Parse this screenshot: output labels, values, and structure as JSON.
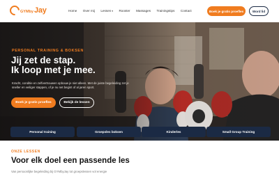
{
  "brand": {
    "logo_small": "GYMbyJay",
    "logo_prefix": "GYM",
    "logo_by": "by",
    "logo_name": "Jay"
  },
  "nav": {
    "items": [
      {
        "label": "Home"
      },
      {
        "label": "Over mij"
      },
      {
        "label": "Lessen",
        "has_dropdown": true
      },
      {
        "label": "Rooster"
      },
      {
        "label": "Massages"
      },
      {
        "label": "Trainingstips"
      },
      {
        "label": "Contact"
      }
    ],
    "cta_label": "Boek je gratis proefles",
    "member_label": "Word lid"
  },
  "hero": {
    "eyebrow": "PERSONAL TRAINING & BOKSEN",
    "headline_line1": "Jij zet de stap.",
    "headline_line2": "Ik loop met je mee.",
    "subtext": "Kracht, conditie en zelfvertrouwen opbouw je niet alleen. Met de juiste begeleiding zet je sneller en veiliger stappen, of je nu net begint of al jaren sport.",
    "cta_label": "Boek je gratis proefles",
    "secondary_label": "Bekijk de lessen"
  },
  "categories": [
    {
      "label": "Personal training"
    },
    {
      "label": "Groepsles boksen"
    },
    {
      "label": "Kinderles"
    },
    {
      "label": "Small Group Training"
    }
  ],
  "lessons": {
    "eyebrow": "ONZE LESSEN",
    "title": "Voor elk doel een passende les",
    "text": "Van persoonlijke begeleiding bij GYMbyJay tot groepslessen vol energie"
  },
  "colors": {
    "accent": "#f07c1f",
    "navy": "#1b2a44",
    "text_dark": "#111111"
  },
  "icons": {
    "logo": "glove-ring-icon",
    "dropdown": "chevron-down-icon"
  }
}
